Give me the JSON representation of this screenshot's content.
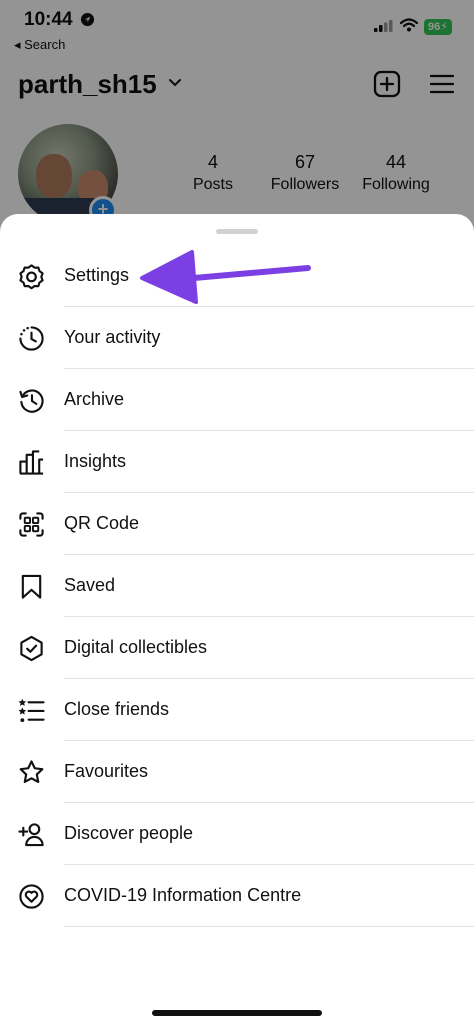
{
  "status_bar": {
    "time": "10:44",
    "back_label": "◂ Search",
    "battery": "96"
  },
  "profile": {
    "username": "parth_sh15",
    "stats": [
      {
        "value": "4",
        "label": "Posts"
      },
      {
        "value": "67",
        "label": "Followers"
      },
      {
        "value": "44",
        "label": "Following"
      }
    ]
  },
  "menu": {
    "items": [
      {
        "icon": "settings-icon",
        "label": "Settings"
      },
      {
        "icon": "activity-icon",
        "label": "Your activity"
      },
      {
        "icon": "archive-icon",
        "label": "Archive"
      },
      {
        "icon": "insights-icon",
        "label": "Insights"
      },
      {
        "icon": "qr-code-icon",
        "label": "QR Code"
      },
      {
        "icon": "bookmark-icon",
        "label": "Saved"
      },
      {
        "icon": "collectibles-icon",
        "label": "Digital collectibles"
      },
      {
        "icon": "close-friends-icon",
        "label": "Close friends"
      },
      {
        "icon": "star-icon",
        "label": "Favourites"
      },
      {
        "icon": "add-person-icon",
        "label": "Discover people"
      },
      {
        "icon": "heart-circle-icon",
        "label": "COVID-19 Information Centre"
      }
    ]
  },
  "colors": {
    "annotation_arrow": "#7b3fe4",
    "battery": "#34c759",
    "avatar_add": "#1f8ef1"
  }
}
